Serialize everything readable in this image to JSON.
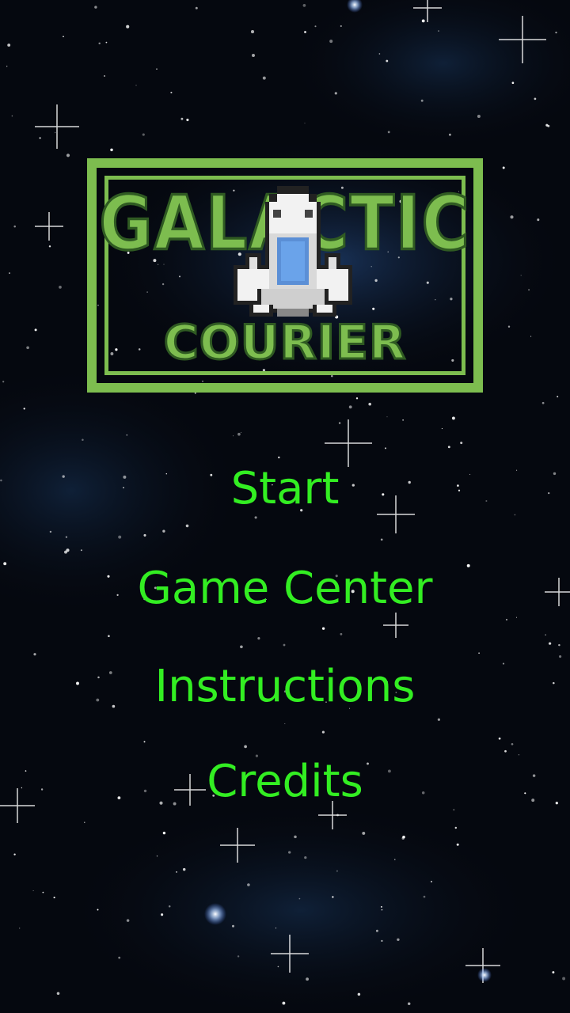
{
  "logo": {
    "title_top": "GALACTIC",
    "title_bottom": "COURIER",
    "border_color": "#7dbd4f"
  },
  "menu": {
    "items": [
      {
        "label": "Start"
      },
      {
        "label": "Game Center"
      },
      {
        "label": "Instructions"
      },
      {
        "label": "Credits"
      }
    ],
    "text_color": "#33ee22"
  },
  "background": {
    "color": "#05080f",
    "nebula_color": "#1c3a66"
  }
}
